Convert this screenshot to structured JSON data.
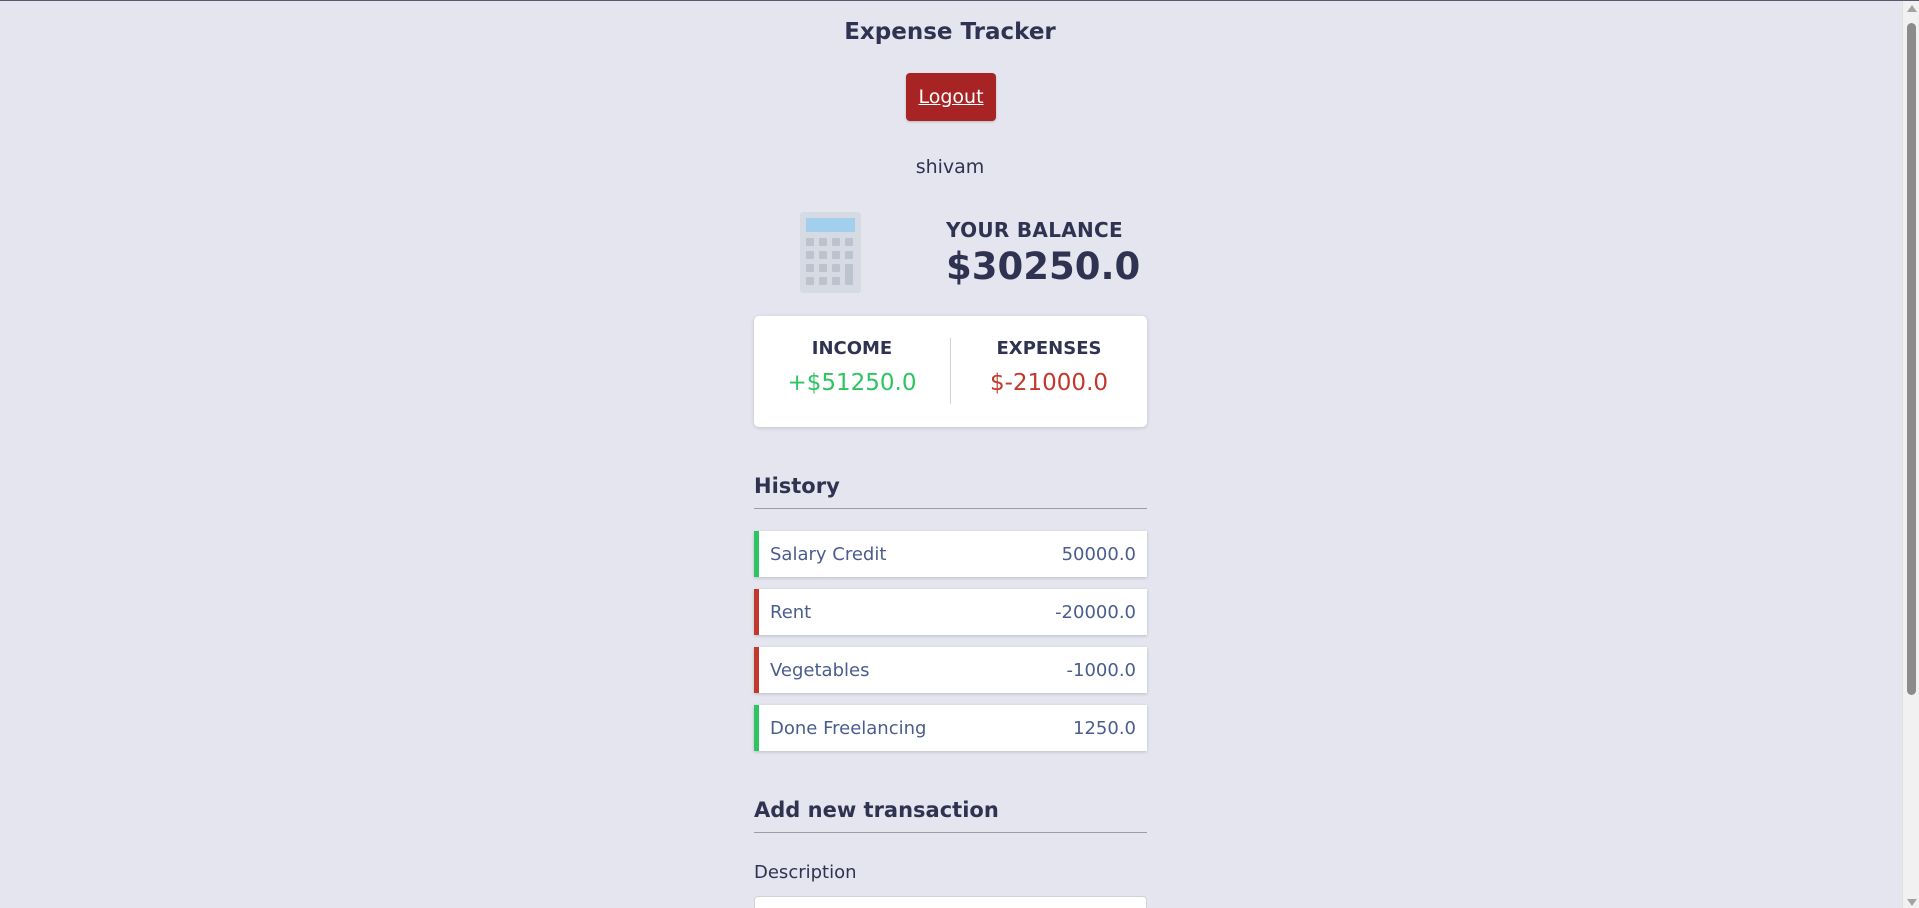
{
  "header": {
    "title": "Expense Tracker",
    "logout_label": "Logout",
    "username": "shivam"
  },
  "balance": {
    "label": "YOUR BALANCE",
    "value": "$30250.0",
    "icon": "calculator-icon"
  },
  "summary": {
    "income_label": "INCOME",
    "income_value": "+$51250.0",
    "expense_label": "EXPENSES",
    "expense_value": "$-21000.0"
  },
  "history": {
    "heading": "History",
    "items": [
      {
        "description": "Salary Credit",
        "amount": "50000.0",
        "type": "plus"
      },
      {
        "description": "Rent",
        "amount": "-20000.0",
        "type": "minus"
      },
      {
        "description": "Vegetables",
        "amount": "-1000.0",
        "type": "minus"
      },
      {
        "description": "Done Freelancing",
        "amount": "1250.0",
        "type": "plus"
      }
    ]
  },
  "add_transaction": {
    "heading": "Add new transaction",
    "description_label": "Description",
    "description_value": ""
  },
  "colors": {
    "background": "#e4e5ee",
    "logout": "#a82424",
    "income": "#2ec462",
    "expense": "#c0392b",
    "text": "#2f3351"
  }
}
